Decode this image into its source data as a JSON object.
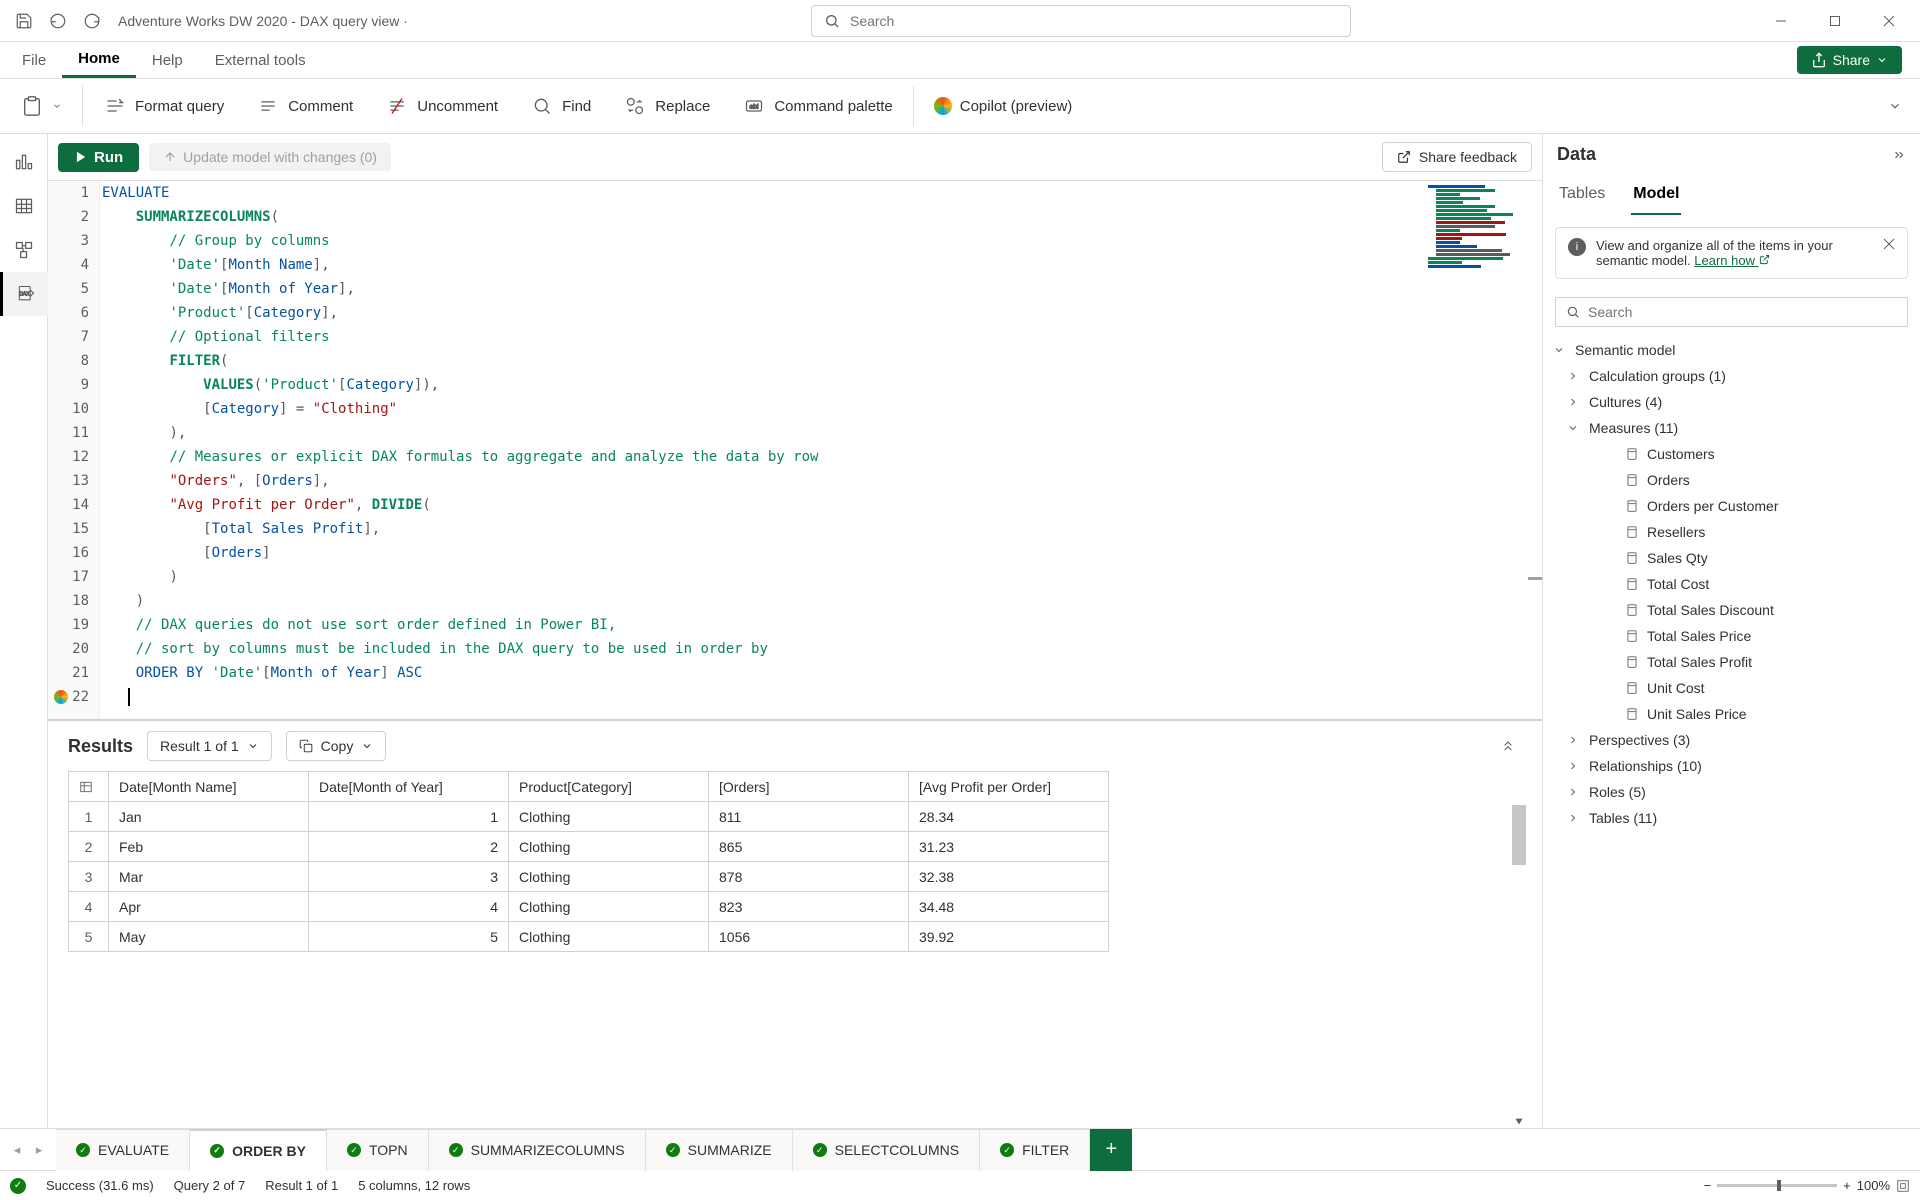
{
  "titlebar": {
    "title": "Adventure Works DW 2020 - DAX query view ·",
    "search_placeholder": "Search"
  },
  "ribbon": {
    "file": "File",
    "home": "Home",
    "help": "Help",
    "external": "External tools",
    "share": "Share"
  },
  "toolbar": {
    "paste": "Paste",
    "format": "Format query",
    "comment": "Comment",
    "uncomment": "Uncomment",
    "find": "Find",
    "replace": "Replace",
    "palette": "Command palette",
    "copilot": "Copilot (preview)"
  },
  "action": {
    "run": "Run",
    "update": "Update model with changes (0)",
    "feedback": "Share feedback"
  },
  "code_tokens": [
    [
      {
        "t": "EVALUATE",
        "c": "kw"
      }
    ],
    [
      {
        "t": "    ",
        "c": ""
      },
      {
        "t": "SUMMARIZECOLUMNS",
        "c": "fn"
      },
      {
        "t": "(",
        "c": "op"
      }
    ],
    [
      {
        "t": "        ",
        "c": ""
      },
      {
        "t": "// Group by columns",
        "c": "cmt"
      }
    ],
    [
      {
        "t": "        ",
        "c": ""
      },
      {
        "t": "'Date'",
        "c": "tbl"
      },
      {
        "t": "[",
        "c": "op"
      },
      {
        "t": "Month Name",
        "c": "col"
      },
      {
        "t": "]",
        "c": "op"
      },
      {
        "t": ",",
        "c": "op"
      }
    ],
    [
      {
        "t": "        ",
        "c": ""
      },
      {
        "t": "'Date'",
        "c": "tbl"
      },
      {
        "t": "[",
        "c": "op"
      },
      {
        "t": "Month of Year",
        "c": "col"
      },
      {
        "t": "]",
        "c": "op"
      },
      {
        "t": ",",
        "c": "op"
      }
    ],
    [
      {
        "t": "        ",
        "c": ""
      },
      {
        "t": "'Product'",
        "c": "tbl"
      },
      {
        "t": "[",
        "c": "op"
      },
      {
        "t": "Category",
        "c": "col"
      },
      {
        "t": "]",
        "c": "op"
      },
      {
        "t": ",",
        "c": "op"
      }
    ],
    [
      {
        "t": "        ",
        "c": ""
      },
      {
        "t": "// Optional filters",
        "c": "cmt"
      }
    ],
    [
      {
        "t": "        ",
        "c": ""
      },
      {
        "t": "FILTER",
        "c": "fn"
      },
      {
        "t": "(",
        "c": "op"
      }
    ],
    [
      {
        "t": "            ",
        "c": ""
      },
      {
        "t": "VALUES",
        "c": "fn"
      },
      {
        "t": "(",
        "c": "op"
      },
      {
        "t": "'Product'",
        "c": "tbl"
      },
      {
        "t": "[",
        "c": "op"
      },
      {
        "t": "Category",
        "c": "col"
      },
      {
        "t": "]",
        "c": "op"
      },
      {
        "t": "),",
        "c": "op"
      }
    ],
    [
      {
        "t": "            ",
        "c": ""
      },
      {
        "t": "[",
        "c": "op"
      },
      {
        "t": "Category",
        "c": "col"
      },
      {
        "t": "]",
        "c": "op"
      },
      {
        "t": " = ",
        "c": "op"
      },
      {
        "t": "\"Clothing\"",
        "c": "str"
      }
    ],
    [
      {
        "t": "        ",
        "c": ""
      },
      {
        "t": "),",
        "c": "op"
      }
    ],
    [
      {
        "t": "        ",
        "c": ""
      },
      {
        "t": "// Measures or explicit DAX formulas to aggregate and analyze the data by row",
        "c": "cmt"
      }
    ],
    [
      {
        "t": "        ",
        "c": ""
      },
      {
        "t": "\"Orders\"",
        "c": "str"
      },
      {
        "t": ", [",
        "c": "op"
      },
      {
        "t": "Orders",
        "c": "col"
      },
      {
        "t": "],",
        "c": "op"
      }
    ],
    [
      {
        "t": "        ",
        "c": ""
      },
      {
        "t": "\"Avg Profit per Order\"",
        "c": "str"
      },
      {
        "t": ", ",
        "c": "op"
      },
      {
        "t": "DIVIDE",
        "c": "fn"
      },
      {
        "t": "(",
        "c": "op"
      }
    ],
    [
      {
        "t": "            ",
        "c": ""
      },
      {
        "t": "[",
        "c": "op"
      },
      {
        "t": "Total Sales Profit",
        "c": "col"
      },
      {
        "t": "],",
        "c": "op"
      }
    ],
    [
      {
        "t": "            ",
        "c": ""
      },
      {
        "t": "[",
        "c": "op"
      },
      {
        "t": "Orders",
        "c": "col"
      },
      {
        "t": "]",
        "c": "op"
      }
    ],
    [
      {
        "t": "        ",
        "c": ""
      },
      {
        "t": ")",
        "c": "op"
      }
    ],
    [
      {
        "t": "    ",
        "c": ""
      },
      {
        "t": ")",
        "c": "op"
      }
    ],
    [
      {
        "t": "    ",
        "c": ""
      },
      {
        "t": "// DAX queries do not use sort order defined in Power BI,",
        "c": "cmt"
      }
    ],
    [
      {
        "t": "    ",
        "c": ""
      },
      {
        "t": "// sort by columns must be included in the DAX query to be used in order by",
        "c": "cmt"
      }
    ],
    [
      {
        "t": "    ",
        "c": ""
      },
      {
        "t": "ORDER BY",
        "c": "kw"
      },
      {
        "t": " ",
        "c": ""
      },
      {
        "t": "'Date'",
        "c": "tbl"
      },
      {
        "t": "[",
        "c": "op"
      },
      {
        "t": "Month of Year",
        "c": "col"
      },
      {
        "t": "]",
        "c": "op"
      },
      {
        "t": " ",
        "c": ""
      },
      {
        "t": "ASC",
        "c": "kw"
      }
    ],
    []
  ],
  "results": {
    "title": "Results",
    "selector": "Result 1 of 1",
    "copy": "Copy",
    "columns": [
      "Date[Month Name]",
      "Date[Month of Year]",
      "Product[Category]",
      "[Orders]",
      "[Avg Profit per Order]"
    ],
    "rows": [
      {
        "idx": "1",
        "c0": "Jan",
        "c1": "1",
        "c2": "Clothing",
        "c3": "811",
        "c4": "28.34"
      },
      {
        "idx": "2",
        "c0": "Feb",
        "c1": "2",
        "c2": "Clothing",
        "c3": "865",
        "c4": "31.23"
      },
      {
        "idx": "3",
        "c0": "Mar",
        "c1": "3",
        "c2": "Clothing",
        "c3": "878",
        "c4": "32.38"
      },
      {
        "idx": "4",
        "c0": "Apr",
        "c1": "4",
        "c2": "Clothing",
        "c3": "823",
        "c4": "34.48"
      },
      {
        "idx": "5",
        "c0": "May",
        "c1": "5",
        "c2": "Clothing",
        "c3": "1056",
        "c4": "39.92"
      }
    ]
  },
  "data_pane": {
    "title": "Data",
    "tab_tables": "Tables",
    "tab_model": "Model",
    "info_text": "View and organize all of the items in your semantic model. ",
    "learn_how": "Learn how",
    "search_placeholder": "Search",
    "root": "Semantic model",
    "calc_groups": "Calculation groups (1)",
    "cultures": "Cultures (4)",
    "measures": "Measures (11)",
    "measure_list": [
      "Customers",
      "Orders",
      "Orders per Customer",
      "Resellers",
      "Sales Qty",
      "Total Cost",
      "Total Sales Discount",
      "Total Sales Price",
      "Total Sales Profit",
      "Unit Cost",
      "Unit Sales Price"
    ],
    "perspectives": "Perspectives (3)",
    "relationships": "Relationships (10)",
    "roles": "Roles (5)",
    "tables": "Tables (11)"
  },
  "qtabs": [
    "EVALUATE",
    "ORDER BY",
    "TOPN",
    "SUMMARIZECOLUMNS",
    "SUMMARIZE",
    "SELECTCOLUMNS",
    "FILTER"
  ],
  "qtabs_active": 1,
  "status": {
    "success": "Success (31.6 ms)",
    "query": "Query 2 of 7",
    "result": "Result 1 of 1",
    "shape": "5 columns, 12 rows",
    "zoom": "100%"
  }
}
